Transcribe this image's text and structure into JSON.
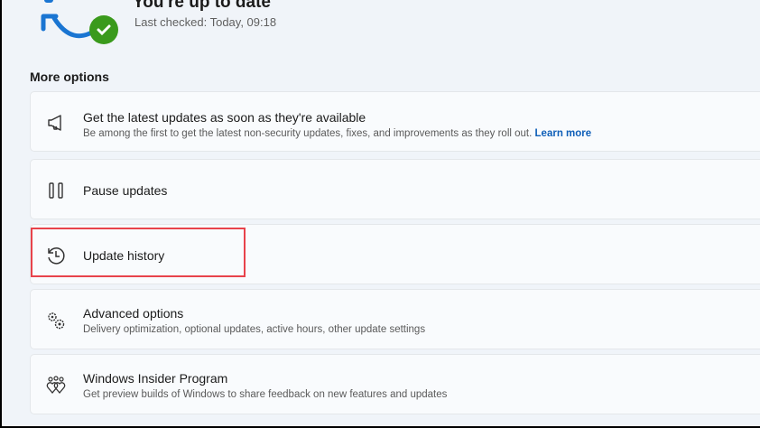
{
  "status": {
    "title": "You're up to date",
    "last_checked": "Last checked: Today, 09:18"
  },
  "section_title": "More options",
  "options": [
    {
      "icon": "megaphone-icon",
      "label": "Get the latest updates as soon as they're available",
      "desc": "Be among the first to get the latest non-security updates, fixes, and improvements as they roll out.",
      "link": "Learn more"
    },
    {
      "icon": "pause-icon",
      "label": "Pause updates"
    },
    {
      "icon": "history-icon",
      "label": "Update history"
    },
    {
      "icon": "gears-icon",
      "label": "Advanced options",
      "desc": "Delivery optimization, optional updates, active hours, other update settings"
    },
    {
      "icon": "insider-hearts-icon",
      "label": "Windows Insider Program",
      "desc": "Get preview builds of Windows to share feedback on new features and updates"
    }
  ],
  "colors": {
    "accent": "#0f5fb8",
    "highlight": "#e8434b",
    "check": "#3a9a1c"
  }
}
